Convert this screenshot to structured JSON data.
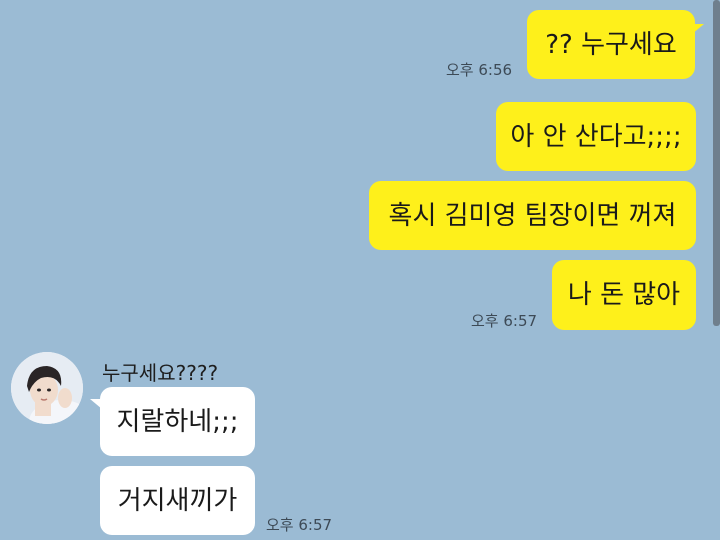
{
  "colors": {
    "background": "#9bbbd4",
    "sent_bubble": "#fef01b",
    "received_bubble": "#ffffff"
  },
  "messages_sent": [
    {
      "text": "?? 누구세요"
    },
    {
      "text": "아 안 산다고;;;;"
    },
    {
      "text": "혹시 김미영 팀장이면 꺼져"
    },
    {
      "text": "나 돈 많아"
    }
  ],
  "sent_times": [
    "오후 6:56",
    "오후 6:57"
  ],
  "received": {
    "sender_name": "누구세요????",
    "avatar_icon": "profile-photo-icon",
    "messages": [
      {
        "text": "지랄하네;;;"
      },
      {
        "text": "거지새끼가"
      }
    ],
    "time": "오후 6:57"
  }
}
